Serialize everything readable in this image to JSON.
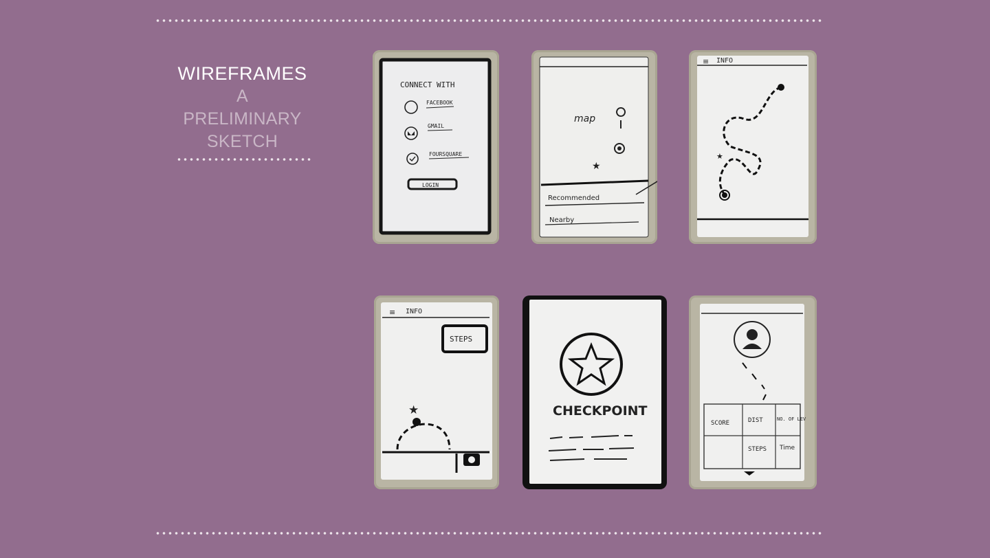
{
  "title": {
    "main": "WIREFRAMES",
    "sub_lines": [
      "A",
      "PRELIMINARY",
      "SKETCH"
    ]
  },
  "colors": {
    "background": "#926d8e",
    "dots": "#ece4ea",
    "tape": "#b9b5a4",
    "paper": "#f2f2f0",
    "ink": "#1c1c1c"
  },
  "sketches": {
    "login": {
      "heading": "CONNECT WITH",
      "options": [
        "FACEBOOK",
        "GMAIL",
        "FOURSQUARE"
      ],
      "button": "LOGIN"
    },
    "map": {
      "label": "map",
      "sections": [
        "Recommended",
        "Nearby"
      ]
    },
    "route": {
      "header": "INFO"
    },
    "steps": {
      "header": "INFO",
      "button": "STEPS"
    },
    "checkpoint": {
      "label": "CHECKPOINT"
    },
    "stats": {
      "cells_top": [
        "SCORE",
        "DIST",
        "NO. OF LEV"
      ],
      "cells_bottom": [
        "",
        "STEPS",
        "Time"
      ]
    }
  }
}
